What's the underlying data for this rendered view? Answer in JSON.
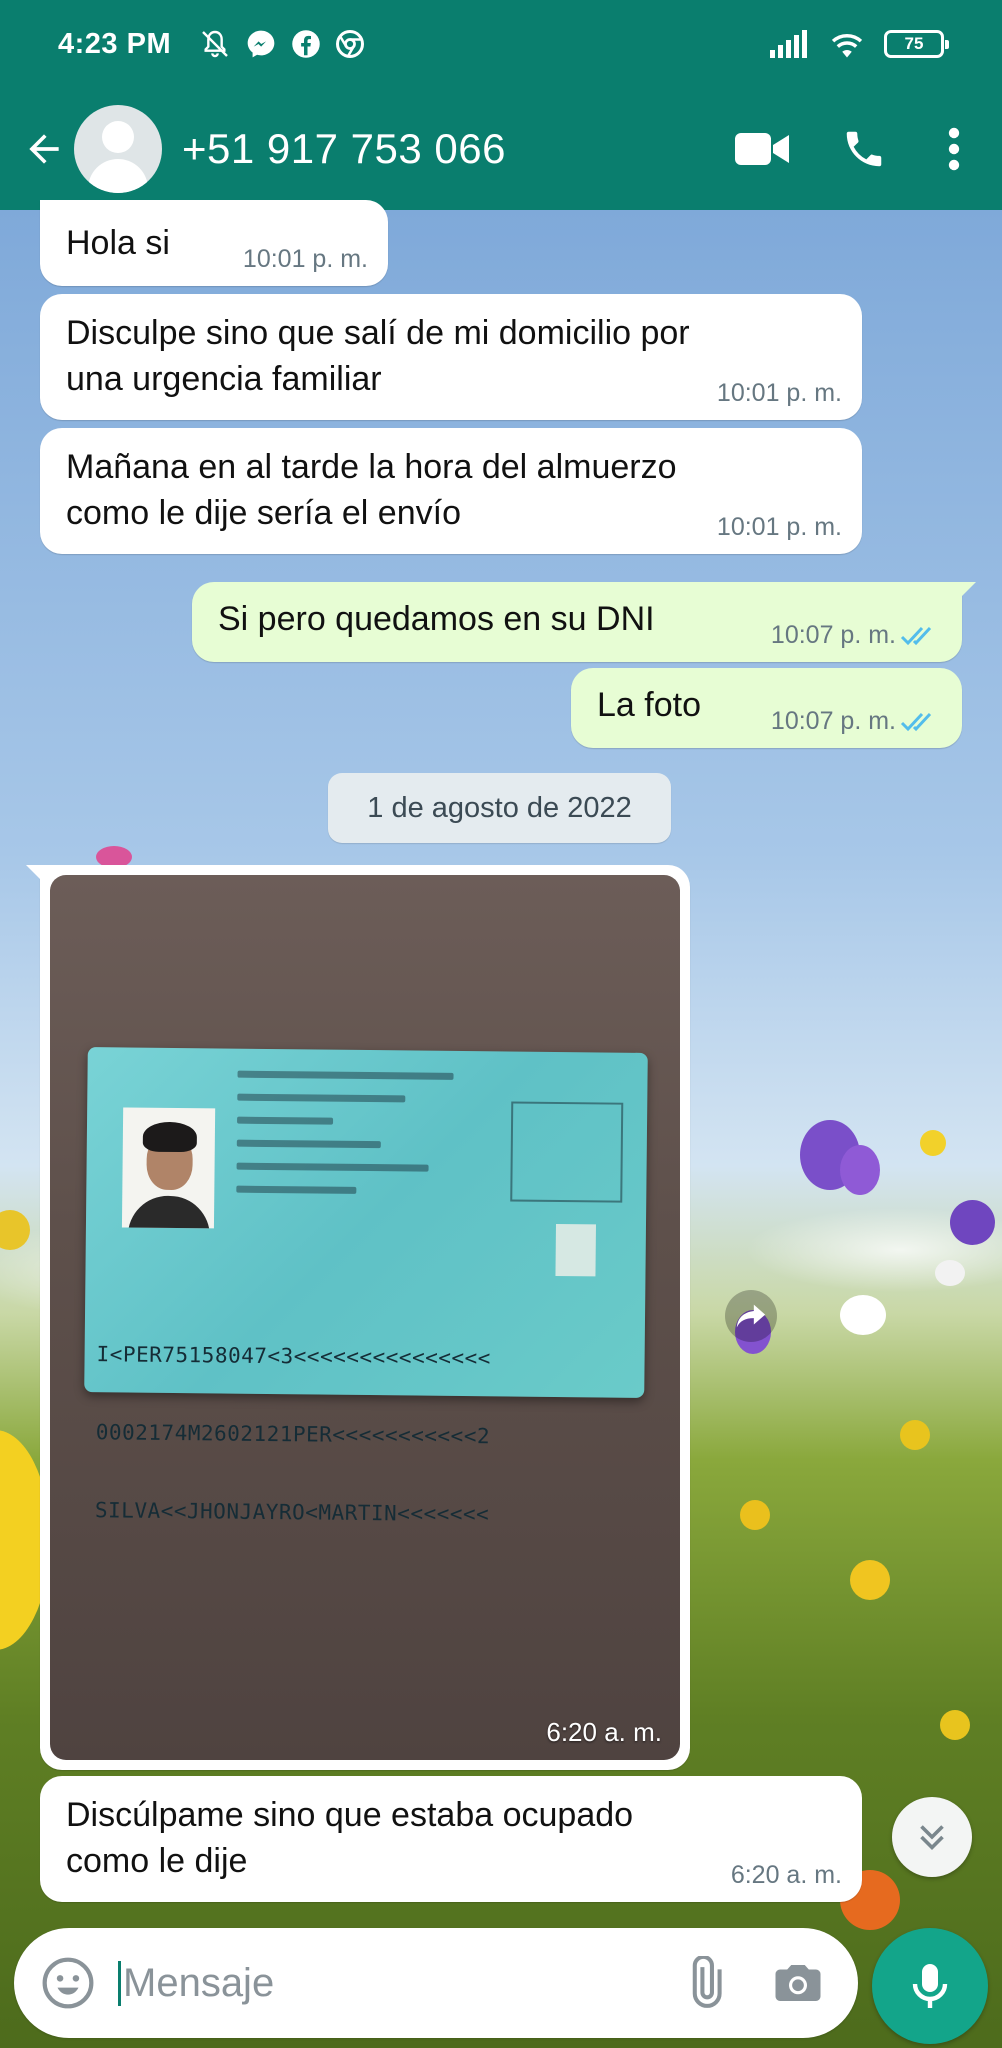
{
  "status_bar": {
    "time": "4:23 PM",
    "battery": "75"
  },
  "header": {
    "contact_name": "+51 917 753 066"
  },
  "messages": [
    {
      "direction": "in",
      "text": "Hola si",
      "time": "10:01 p. m."
    },
    {
      "direction": "in",
      "text_lines": [
        "Disculpe sino que salí de mi domicilio por",
        "una urgencia familiar"
      ],
      "time": "10:01 p. m."
    },
    {
      "direction": "in",
      "text_lines": [
        "Mañana en al tarde la hora del almuerzo",
        "como le dije sería el envío"
      ],
      "time": "10:01 p. m."
    },
    {
      "direction": "out",
      "text": "Si pero quedamos en su DNI",
      "time": "10:07 p. m.",
      "status": "read"
    },
    {
      "direction": "out",
      "text": "La foto",
      "time": "10:07 p. m.",
      "status": "read"
    }
  ],
  "date_separator": "1 de agosto de 2022",
  "image_message": {
    "time": "6:20 a. m.",
    "mrz_lines": [
      "I<PER75158047<3<<<<<<<<<<<<<<<",
      "0002174M2602121PER<<<<<<<<<<<2",
      "SILVA<<JHONJAYRO<MARTIN<<<<<<<"
    ]
  },
  "last_message": {
    "direction": "in",
    "text_lines": [
      "Discúlpame sino que estaba ocupado",
      "como le dije"
    ],
    "time": "6:20 a. m."
  },
  "composer": {
    "placeholder": "Mensaje"
  },
  "colors": {
    "header": "#0a7e6e",
    "outgoing_bubble": "#e7fdd4",
    "incoming_bubble": "#ffffff",
    "read_ticks": "#53bdeb",
    "mic_button": "#13a58a"
  },
  "icons": {
    "back": "back-arrow-icon",
    "video": "video-call-icon",
    "call": "phone-icon",
    "menu": "more-vert-icon",
    "emoji": "emoji-icon",
    "attach": "paperclip-icon",
    "camera": "camera-icon",
    "mic": "mic-icon",
    "forward": "forward-icon",
    "scroll_down": "double-chevron-down-icon"
  }
}
